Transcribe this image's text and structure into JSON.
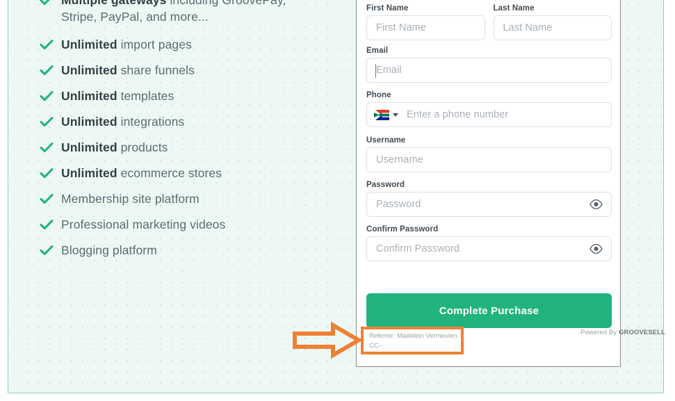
{
  "colors": {
    "mint_background": "#edf8f4",
    "mint_border": "#8fd0bb",
    "dot_color": "#cfe3db",
    "brand_green": "#21b37d",
    "check_green": "#21b37d",
    "annotation_orange": "#ef8033",
    "label_dark": "#3f4a52",
    "placeholder_gray": "#a9b0b8",
    "card_border": "#8b8b8b"
  },
  "features": [
    {
      "bold": "Multiple gateways",
      "rest": " including GroovePay, Stripe, PayPal, and more...",
      "clipped": true
    },
    {
      "bold": "Unlimited",
      "rest": " import pages"
    },
    {
      "bold": "Unlimited",
      "rest": " share funnels"
    },
    {
      "bold": "Unlimited",
      "rest": " templates"
    },
    {
      "bold": "Unlimited",
      "rest": " integrations"
    },
    {
      "bold": "Unlimited",
      "rest": " products"
    },
    {
      "bold": "Unlimited",
      "rest": " ecommerce stores"
    },
    {
      "bold": "",
      "rest": "Membership site platform"
    },
    {
      "bold": "",
      "rest": "Professional marketing videos"
    },
    {
      "bold": "",
      "rest": "Blogging platform"
    }
  ],
  "form": {
    "first_name": {
      "label": "First Name",
      "placeholder": "First Name",
      "value": ""
    },
    "last_name": {
      "label": "Last Name",
      "placeholder": "Last Name",
      "value": ""
    },
    "email": {
      "label": "Email",
      "placeholder": "Email",
      "value": "",
      "focused": true
    },
    "phone": {
      "label": "Phone",
      "placeholder": "Enter a phone number",
      "value": "",
      "country_flag": "south-africa"
    },
    "username": {
      "label": "Username",
      "placeholder": "Username",
      "value": ""
    },
    "password": {
      "label": "Password",
      "placeholder": "Password",
      "value": ""
    },
    "confirm_password": {
      "label": "Confirm Password",
      "placeholder": "Confirm Password",
      "value": ""
    }
  },
  "purchase_button": {
    "label": "Complete Purchase"
  },
  "footer": {
    "referrer_line1": "Referrer: Madelein Vermeulen",
    "referrer_line2": "CC-",
    "powered_prefix": "Powered By ",
    "powered_brand": "GROOVESELL"
  },
  "annotation": {
    "arrow": "right-arrow",
    "highlight_target": "referrer-box"
  }
}
